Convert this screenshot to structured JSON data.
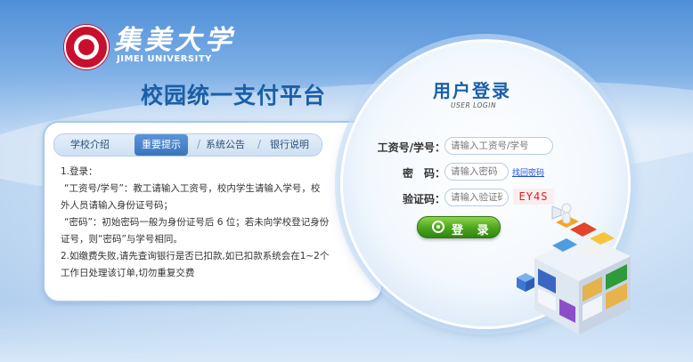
{
  "university": {
    "name_cn": "集美大学",
    "name_en": "JIMEI UNIVERSITY"
  },
  "platform_title": "校园统一支付平台",
  "tabs": [
    {
      "label": "学校介绍",
      "active": false
    },
    {
      "label": "重要提示",
      "active": true
    },
    {
      "label": "系统公告",
      "active": false
    },
    {
      "label": "银行说明",
      "active": false
    }
  ],
  "notice": {
    "lines": [
      "1.登录：",
      "“工资号/学号”：教工请输入工资号，校内学生请输入学号，校",
      "外人员请输入身份证号码；",
      "“密码”：初始密码一般为身份证号后 6 位；若未向学校登记身份",
      "证号，则“密码”与学号相同。",
      "2.如缴费失败,请先查询银行是否已扣款,如已扣款系统会在1~2个",
      "工作日处理该订单,切勿重复交费"
    ]
  },
  "login": {
    "title": "用户登录",
    "subtitle": "USER LOGIN",
    "account_label": "工资号/学号：",
    "account_placeholder": "请输入工资号/学号",
    "password_label": "密　码：",
    "password_placeholder": "请输入密码",
    "forgot_link": "找回密码",
    "captcha_label": "验证码：",
    "captcha_placeholder": "请输入验证码",
    "captcha_code": "EY4S",
    "submit_label": "登 录",
    "submit_icon": "login-icon"
  },
  "colors": {
    "accent_blue": "#1a5fa8",
    "button_green": "#4aa51b",
    "captcha_red": "#e21d1d",
    "link_blue": "#1b4fd6",
    "logo_red": "#c8102e"
  }
}
